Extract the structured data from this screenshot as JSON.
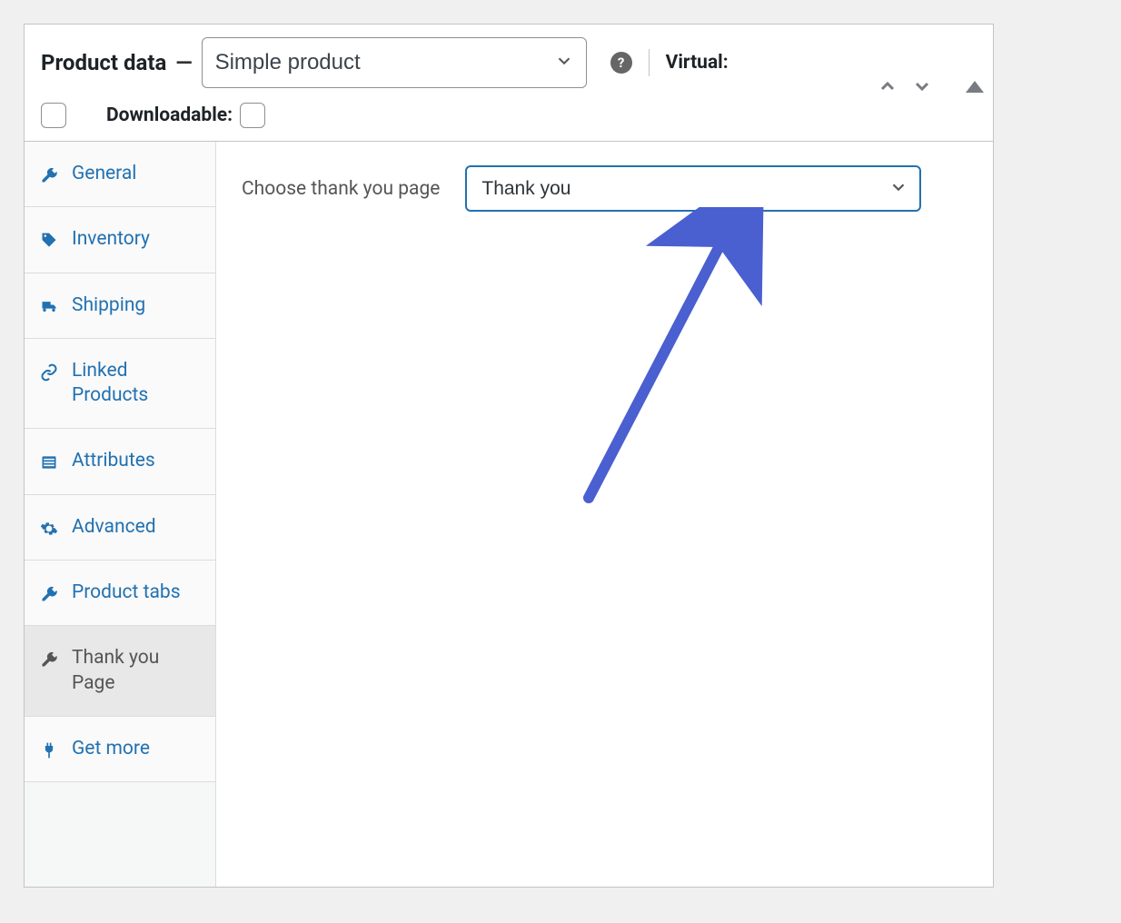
{
  "header": {
    "title": "Product data",
    "product_type": "Simple product",
    "virtual_label": "Virtual:",
    "downloadable_label": "Downloadable:"
  },
  "sidebar": {
    "items": [
      {
        "icon": "wrench-icon",
        "label": "General"
      },
      {
        "icon": "tag-icon",
        "label": "Inventory"
      },
      {
        "icon": "truck-icon",
        "label": "Shipping"
      },
      {
        "icon": "link-icon",
        "label": "Linked Products"
      },
      {
        "icon": "list-icon",
        "label": "Attributes"
      },
      {
        "icon": "gear-icon",
        "label": "Advanced"
      },
      {
        "icon": "wrench-icon",
        "label": "Product tabs"
      },
      {
        "icon": "wrench-icon",
        "label": "Thank you Page",
        "active": true
      },
      {
        "icon": "plug-icon",
        "label": "Get more"
      }
    ]
  },
  "content": {
    "field_label": "Choose thank you page",
    "selected_value": "Thank you"
  }
}
